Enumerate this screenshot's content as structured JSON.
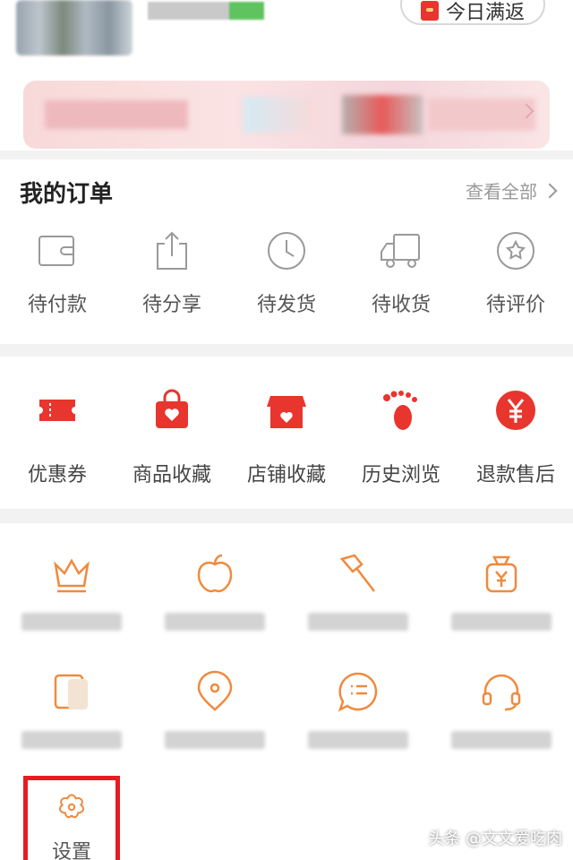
{
  "header": {
    "today_rebate_label": "今日满返"
  },
  "orders": {
    "title": "我的订单",
    "view_all": "查看全部",
    "items": [
      {
        "label": "待付款",
        "icon": "wallet-icon"
      },
      {
        "label": "待分享",
        "icon": "share-icon"
      },
      {
        "label": "待发货",
        "icon": "clock-icon"
      },
      {
        "label": "待收货",
        "icon": "truck-icon"
      },
      {
        "label": "待评价",
        "icon": "review-star-icon"
      }
    ]
  },
  "quick": {
    "items": [
      {
        "label": "优惠券",
        "icon": "coupon-icon"
      },
      {
        "label": "商品收藏",
        "icon": "bag-heart-icon"
      },
      {
        "label": "店铺收藏",
        "icon": "store-heart-icon"
      },
      {
        "label": "历史浏览",
        "icon": "footprint-icon"
      },
      {
        "label": "退款售后",
        "icon": "yuan-icon"
      }
    ]
  },
  "tools": {
    "row1": [
      {
        "icon": "crown-icon"
      },
      {
        "icon": "apple-icon"
      },
      {
        "icon": "axe-icon"
      },
      {
        "icon": "money-bag-icon"
      }
    ],
    "row2": [
      {
        "icon": "card-icon"
      },
      {
        "icon": "location-pin-icon"
      },
      {
        "icon": "chat-bubble-icon"
      },
      {
        "icon": "headset-icon"
      }
    ]
  },
  "settings": {
    "label": "设置",
    "icon": "gear-flower-icon"
  },
  "watermark": "头条 @文文爱吃肉",
  "colors": {
    "accent_red": "#e8352e",
    "tool_orange": "#f08a3c",
    "highlight_border": "#e51c23"
  }
}
